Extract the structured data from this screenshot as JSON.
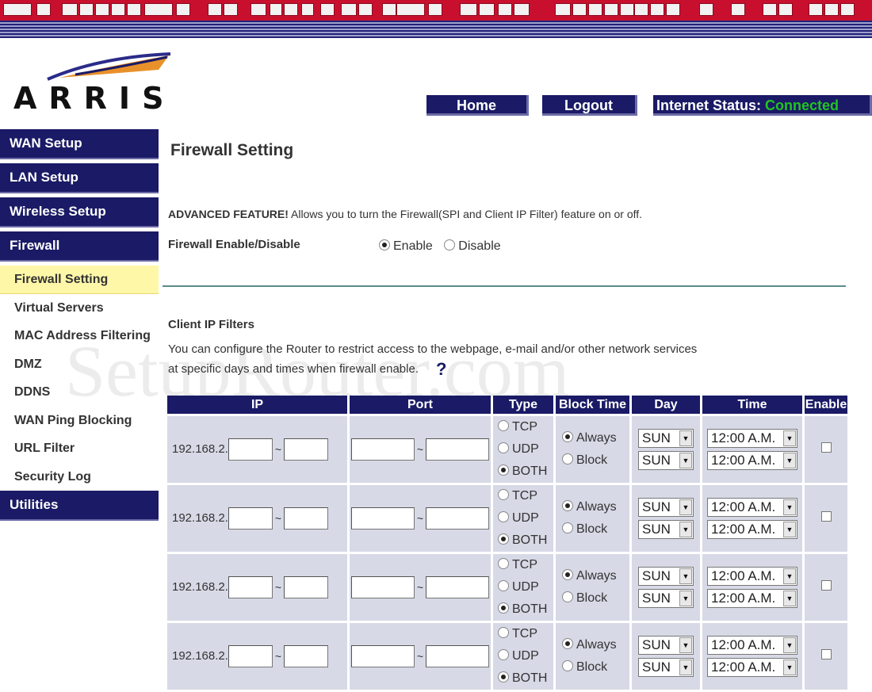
{
  "brand": {
    "logo_text": "ARRIS"
  },
  "topnav": {
    "home": "Home",
    "logout": "Logout",
    "status_label": "Internet Status:",
    "status_value": "Connected"
  },
  "sidebar": {
    "items": [
      {
        "label": "WAN Setup",
        "type": "main"
      },
      {
        "label": "LAN Setup",
        "type": "main"
      },
      {
        "label": "Wireless Setup",
        "type": "main"
      },
      {
        "label": "Firewall",
        "type": "main"
      },
      {
        "label": "Firewall Setting",
        "type": "sub",
        "active": true
      },
      {
        "label": "Virtual Servers",
        "type": "sub"
      },
      {
        "label": "MAC Address Filtering",
        "type": "sub"
      },
      {
        "label": "DMZ",
        "type": "sub"
      },
      {
        "label": "DDNS",
        "type": "sub"
      },
      {
        "label": "WAN Ping Blocking",
        "type": "sub"
      },
      {
        "label": "URL Filter",
        "type": "sub"
      },
      {
        "label": "Security Log",
        "type": "sub"
      },
      {
        "label": "Utilities",
        "type": "main"
      }
    ]
  },
  "main": {
    "title": "Firewall Setting",
    "advanced_bold": "ADVANCED FEATURE!",
    "advanced_text": " Allows you to turn the Firewall(SPI and Client IP Filter) feature on or off.",
    "fw_label": "Firewall Enable/Disable",
    "fw_enable": "Enable",
    "fw_disable": "Disable",
    "client_title": "Client IP Filters",
    "client_desc1": "You can configure the Router to restrict access to the webpage, e-mail and/or other network services",
    "client_desc2": "at specific days and times when firewall enable.",
    "help_glyph": "?",
    "watermark": "SetupRouter.com"
  },
  "table": {
    "headers": {
      "ip": "IP",
      "port": "Port",
      "type": "Type",
      "block_time": "Block Time",
      "day": "Day",
      "time": "Time",
      "enable": "Enable"
    },
    "ip_prefix": "192.168.2.",
    "tilde": "~",
    "type_options": [
      "TCP",
      "UDP",
      "BOTH"
    ],
    "block_options": [
      "Always",
      "Block"
    ],
    "day_value": "SUN",
    "time_value": "12:00 A.M.",
    "row_count": 4
  }
}
